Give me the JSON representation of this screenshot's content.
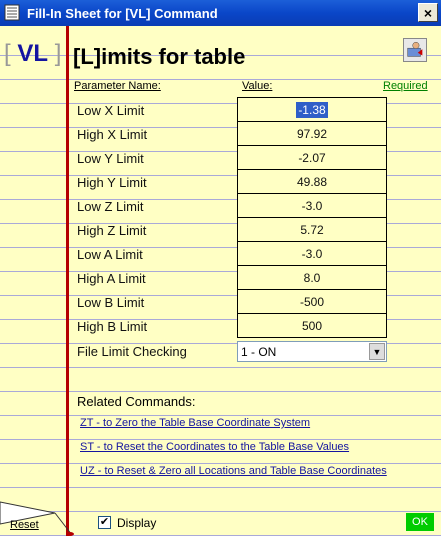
{
  "window": {
    "title": "Fill-In Sheet for [VL] Command",
    "close_label": "×"
  },
  "header": {
    "bracket_open": "[",
    "command_code": "VL",
    "bracket_close": "]",
    "heading": "[L]imits for table"
  },
  "columns": {
    "parameter": "Parameter Name:",
    "value": "Value:",
    "required": "Required"
  },
  "rows": [
    {
      "label": "Low X Limit",
      "value": "-1.38"
    },
    {
      "label": "High X Limit",
      "value": "97.92"
    },
    {
      "label": "Low Y Limit",
      "value": "-2.07"
    },
    {
      "label": "High Y Limit",
      "value": "49.88"
    },
    {
      "label": "Low Z Limit",
      "value": "-3.0"
    },
    {
      "label": "High Z Limit",
      "value": "5.72"
    },
    {
      "label": "Low A Limit",
      "value": "-3.0"
    },
    {
      "label": "High A Limit",
      "value": "8.0"
    },
    {
      "label": "Low B Limit",
      "value": "-500"
    },
    {
      "label": "High B Limit",
      "value": "500"
    }
  ],
  "file_limit": {
    "label": "File Limit Checking",
    "value": "1 - ON"
  },
  "related": {
    "title": "Related Commands:",
    "links": [
      "ZT - to Zero the Table Base Coordinate System",
      "ST - to Reset the Coordinates to the Table Base Values",
      "UZ - to Reset & Zero all Locations and Table Base Coordinates"
    ]
  },
  "footer": {
    "reset": "Reset",
    "display": "Display",
    "display_checked": true,
    "ok": "OK"
  },
  "colors": {
    "paper": "#ffffc4",
    "margin_line": "#b40000",
    "ok_button": "#00cc00",
    "title_bar": "#0a46c8",
    "link": "#1515a0"
  }
}
